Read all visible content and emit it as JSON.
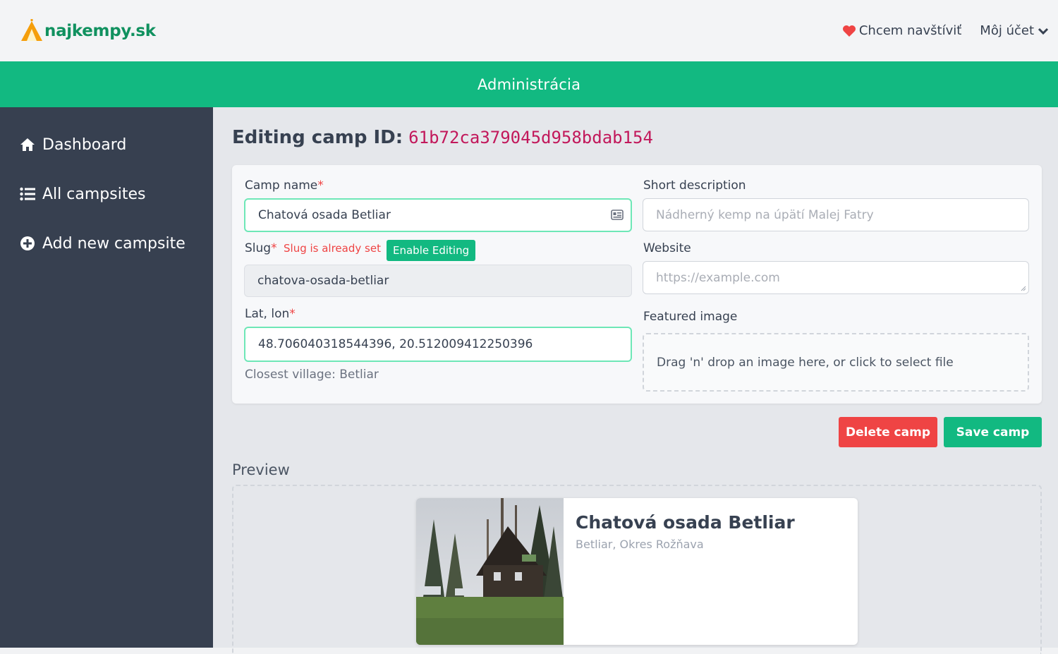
{
  "brand": {
    "logo_text": "najkempy.sk"
  },
  "topnav": {
    "wishlist_label": "Chcem navštíviť",
    "account_label": "Môj účet"
  },
  "banner": {
    "title": "Administrácia"
  },
  "sidebar": {
    "items": [
      {
        "label": "Dashboard",
        "icon": "home-icon"
      },
      {
        "label": "All campsites",
        "icon": "list-icon"
      },
      {
        "label": "Add new campsite",
        "icon": "plus-circle-icon"
      }
    ]
  },
  "page": {
    "title_prefix": "Editing camp ID:",
    "camp_id": "61b72ca379045d958bdab154"
  },
  "form": {
    "camp_name_label": "Camp name",
    "camp_name_value": "Chatová osada Betliar",
    "slug_label": "Slug",
    "slug_note": "Slug is already set",
    "enable_editing_label": "Enable Editing",
    "slug_value": "chatova-osada-betliar",
    "latlon_label": "Lat, lon",
    "latlon_value": "48.706040318544396, 20.512009412250396",
    "closest_village": "Closest village: Betliar",
    "short_desc_label": "Short description",
    "short_desc_placeholder": "Nádherný kemp na úpätí Malej Fatry",
    "website_label": "Website",
    "website_placeholder": "https://example.com",
    "featured_image_label": "Featured image",
    "dropzone_text": "Drag 'n' drop an image here, or click to select file",
    "required_mark": "*"
  },
  "actions": {
    "delete_label": "Delete camp",
    "save_label": "Save camp"
  },
  "preview": {
    "label": "Preview",
    "card_title": "Chatová osada Betliar",
    "card_subtitle": "Betliar, Okres Rožňava"
  },
  "colors": {
    "brand_green": "#12b981",
    "sidebar": "#374050",
    "danger": "#ef4444",
    "id_pink": "#c2185b"
  }
}
